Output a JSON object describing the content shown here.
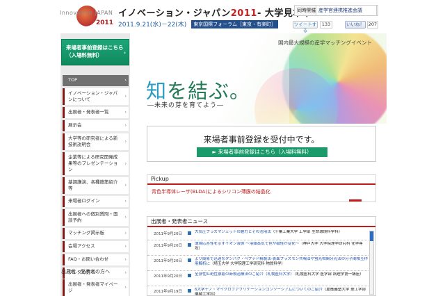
{
  "header": {
    "logo_text": "Innovation JAPAN",
    "logo_year": "2011",
    "title_main": "イノベーション・ジャパン",
    "title_year": "2011",
    "title_tail": "- 大学見本市",
    "date_text": "2011.9.21(水)－22(木)",
    "venue": "東京国際フォーラム［東京・有楽町］",
    "organizer_label": "同時開催",
    "organizer_name": "産学官連携推進会議",
    "tweet_label": "ツイートする",
    "tweet_count": "133",
    "like_label": "いいね！",
    "like_count": "207"
  },
  "sidebar": {
    "register_banner_line1": "来場者事前登録はこちら",
    "register_banner_line2": "（入場料無料）",
    "nav": [
      {
        "label": "TOP",
        "active": true
      },
      {
        "label": "イノベーション・ジャパンについて"
      },
      {
        "label": "出展者・発表者一覧"
      },
      {
        "label": "展示会"
      },
      {
        "label": "大学等の研究者による新技術説明会"
      },
      {
        "label": "企業等による研究開発成果等のプレゼンテーション"
      },
      {
        "label": "基調講演、各種施策紹介等"
      },
      {
        "label": "来場者ログイン"
      },
      {
        "label": "出展者への個別質問・面談予約"
      },
      {
        "label": "マッチング掲示板"
      },
      {
        "label": "会場アクセス"
      },
      {
        "label": "FAQ・お問い合わせ"
      },
      {
        "label": "プレスの方へ"
      }
    ],
    "exhibitor_heading": "出展者・発表者の方へ",
    "exhibitor_mypage": "出展者・発表者マイページ"
  },
  "hero": {
    "tagline_top": "国内最大規模の産学マッチングイベント",
    "catch_k1": "知",
    "catch_rest": "を結ぶ。",
    "subtitle": "―未来の芽を育てよう―"
  },
  "announce": {
    "title": "来場者事前登録を受付中です。",
    "cta": "► 来場者事前登録はこちら（入場料無料）"
  },
  "pickup": {
    "heading": "Pickup",
    "text": "青色半導体レーザ(BLDA)によるシリコン薄膜の結晶化"
  },
  "news": {
    "heading": "出展者・発表者ニュース",
    "items": [
      {
        "date": "2011年9月20日",
        "title": "大気圧プラズマジェットの魅力とその活用法",
        "sub": "（千葉工業大学 工学部 生命環境科学科）"
      },
      {
        "date": "2011年9月20日",
        "title": "環境応答性を示すイオン液体 ～溶媒蒸気で色や磁性が変化～",
        "sub": "（神戸大学 大学院理学研究科 化学専攻）"
      },
      {
        "date": "2011年9月20日",
        "title": "より簡易で迅速なタンパク・ペプチド精製法-表面プラズモン共鳴法や蛍光相関分光法の分子間相互作用解析に",
        "sub": "（埼玉大学 大学院理工学研究科 物質科学）"
      },
      {
        "date": "2011年9月20日",
        "title": "全身性紅斑性狼瘡の新規治療法のご紹介（札幌医科大学）",
        "sub": "（札幌医科大学 医学部 病理学第一講座）"
      },
      {
        "date": "2011年9月19日",
        "title": "6大学ナノ・マイクロファブリケーションコンソーシアムについてのご紹介",
        "sub": "（慶應義塾大学 理工学部 機械工学科）"
      }
    ]
  }
}
